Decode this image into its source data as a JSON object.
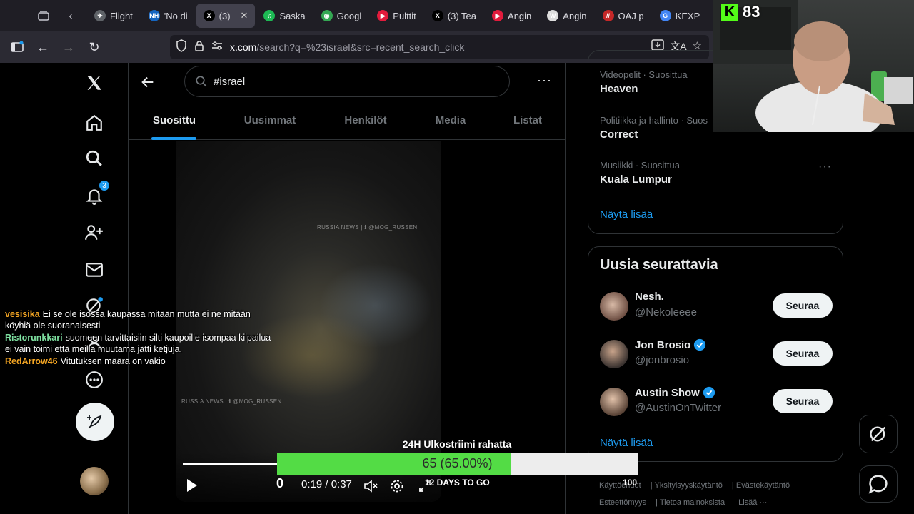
{
  "browser": {
    "tabs": [
      {
        "label": "Flight",
        "fav_color": "#5f6368",
        "fav_glyph": "✈"
      },
      {
        "label": "'No di",
        "fav_color": "#1565c0",
        "fav_glyph": "NH"
      },
      {
        "label": "(3)",
        "fav_color": "#000000",
        "fav_glyph": "X",
        "active": true
      },
      {
        "label": "Saska",
        "fav_color": "#1db954",
        "fav_glyph": "♫"
      },
      {
        "label": "Googl",
        "fav_color": "#34a853",
        "fav_glyph": "◉"
      },
      {
        "label": "Pulttit",
        "fav_color": "#e21b3c",
        "fav_glyph": "▶"
      },
      {
        "label": "(3) Tea",
        "fav_color": "#000000",
        "fav_glyph": "X"
      },
      {
        "label": "Angin",
        "fav_color": "#e21b3c",
        "fav_glyph": "▶"
      },
      {
        "label": "Angin",
        "fav_color": "#dddddd",
        "fav_glyph": "W"
      },
      {
        "label": "OAJ p",
        "fav_color": "#c62828",
        "fav_glyph": "//"
      },
      {
        "label": "KEXP",
        "fav_color": "#4285f4",
        "fav_glyph": "G"
      }
    ],
    "url_host": "x.com",
    "url_path": "/search?q=%23israel&src=recent_search_click"
  },
  "nav": {
    "notifications_badge": "3"
  },
  "search": {
    "query": "#israel"
  },
  "tabs": [
    "Suosittu",
    "Uusimmat",
    "Henkilöt",
    "Media",
    "Listat"
  ],
  "video": {
    "watermark1": "RUSSIA NEWS | ℹ @MOG_RUSSEN",
    "watermark2": "RUSSIA NEWS | ℹ @MOG_RUSSEN",
    "timecode": "0:19 / 0:37",
    "progress": 0.514
  },
  "trends": [
    {
      "meta": "Videopelit · Suosittua",
      "name": "Heaven"
    },
    {
      "meta": "Politiikka ja hallinto · Suos",
      "name": "Correct"
    },
    {
      "meta": "Musiikki · Suosittua",
      "name": "Kuala Lumpur"
    }
  ],
  "trends_more": "Näytä lisää",
  "who_to_follow": {
    "title": "Uusia seurattavia",
    "accounts": [
      {
        "name": "Nesh.",
        "handle": "@Nekoleeee",
        "verified": false,
        "button": "Seuraa"
      },
      {
        "name": "Jon Brosio",
        "handle": "@jonbrosio",
        "verified": true,
        "button": "Seuraa"
      },
      {
        "name": "Austin Show",
        "handle": "@AustinOnTwitter",
        "verified": true,
        "button": "Seuraa"
      }
    ],
    "more": "Näytä lisää"
  },
  "footer": {
    "line1": [
      "Käyttöehdot",
      "Yksityisyyskäytäntö",
      "Evästekäytäntö"
    ],
    "line2": [
      "Esteettömyys",
      "Tietoa mainoksista",
      "Lisää ···"
    ]
  },
  "stream": {
    "viewer_count": "83",
    "chat": [
      {
        "user": "vesisika",
        "color": "#f5a623",
        "text": "Ei se ole isossa kaupassa mitään mutta ei ne mitään köyhiä ole suoranaisesti"
      },
      {
        "user": "Ristorunkkari",
        "color": "#7ee0a0",
        "text": "suomeen tarvittaisiin silti kaupoille isompaa kilpailua ei vain toimi että meillä muutama jätti ketjuja."
      },
      {
        "user": "RedArrow46",
        "color": "#f5a623",
        "text": "Vitutuksen määrä on vakio"
      }
    ],
    "goal": {
      "title": "24H Ulkostriimi rahatta",
      "label": "65 (65.00%)",
      "fraction": 0.65,
      "min": "0",
      "max": "100",
      "days": "12 DAYS TO GO"
    }
  }
}
